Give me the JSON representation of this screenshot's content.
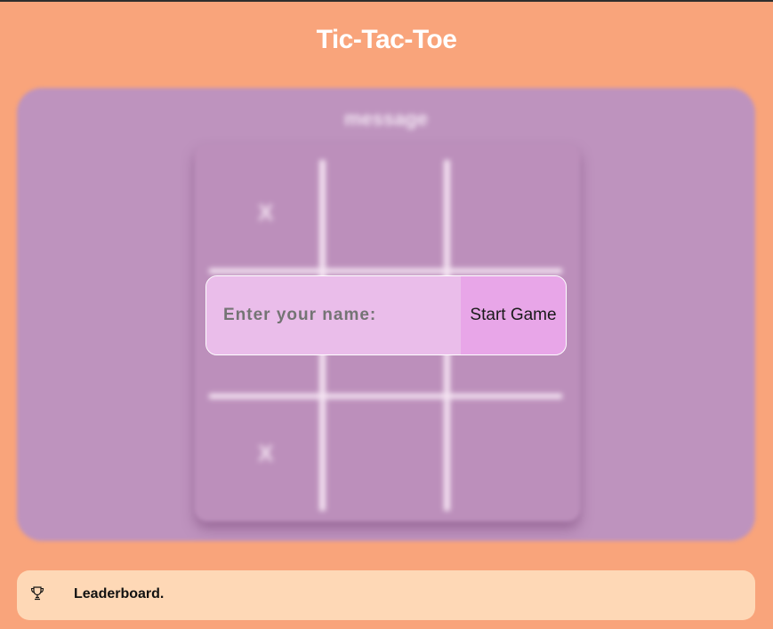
{
  "header": {
    "title": "Tic-Tac-Toe"
  },
  "game": {
    "message": "message",
    "cells": [
      "X",
      "",
      "",
      "",
      "",
      "",
      "X",
      "",
      ""
    ]
  },
  "start_form": {
    "name_placeholder": "Enter your name:",
    "start_button_label": "Start Game"
  },
  "leaderboard": {
    "label": "Leaderboard.",
    "icon": "trophy-icon"
  },
  "colors": {
    "background": "#f9a47b",
    "panel": "#be93be",
    "input": "#eabdea",
    "button": "#e8a6e8",
    "leaderboard_bar": "#fed8b6"
  }
}
